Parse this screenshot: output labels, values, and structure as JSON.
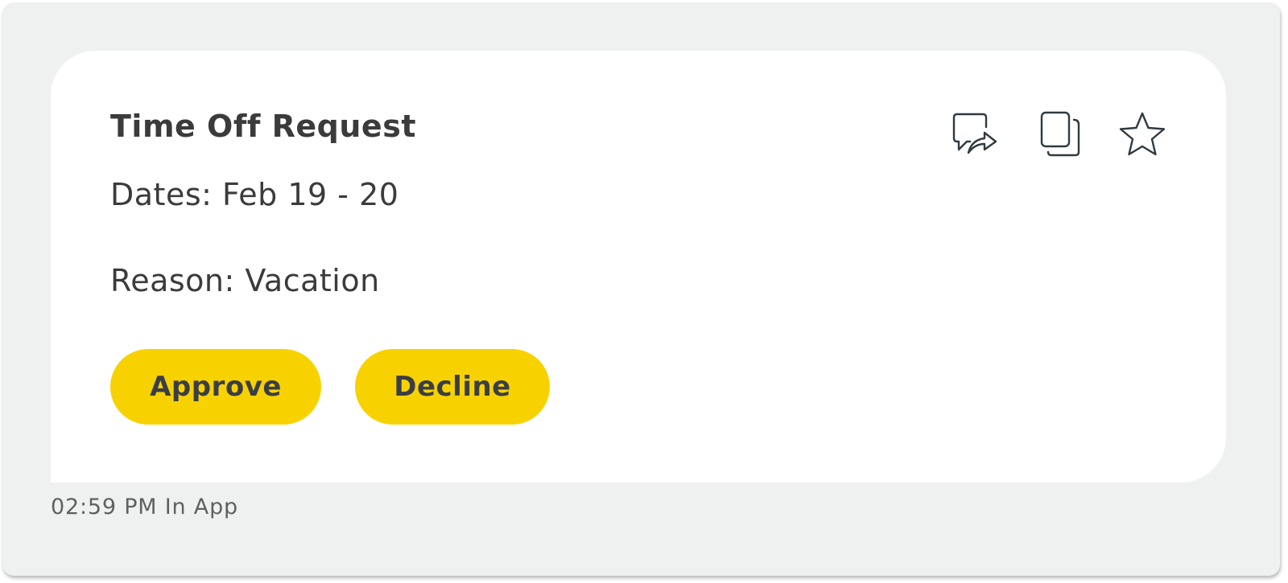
{
  "message": {
    "title": "Time Off Request",
    "dates_line": "Dates: Feb 19 - 20",
    "reason_line": "Reason: Vacation",
    "actions": {
      "approve_label": "Approve",
      "decline_label": "Decline"
    },
    "toolbar_icons": [
      "reply-icon",
      "copy-icon",
      "star-icon"
    ],
    "footer": "02:59 PM In App"
  },
  "colors": {
    "background": "#eff1f0",
    "card": "#ffffff",
    "button": "#f8d200",
    "button_text": "#3a3e44",
    "text": "#3b3b3b",
    "icon_stroke": "#2f3a40"
  }
}
